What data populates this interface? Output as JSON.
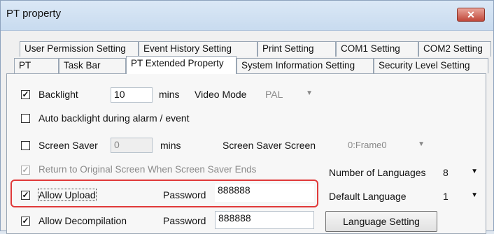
{
  "window": {
    "title": "PT property",
    "close_glyph": "✕"
  },
  "tabs_row1": [
    "User Permission Setting",
    "Event History Setting",
    "Print Setting",
    "COM1 Setting",
    "COM2 Setting"
  ],
  "tabs_row2": [
    "PT",
    "Task Bar",
    "PT Extended Property",
    "System Information Setting",
    "Security Level Setting"
  ],
  "active_tab": "PT Extended Property",
  "backlight": {
    "label": "Backlight",
    "checked": true,
    "value": "10",
    "unit": "mins"
  },
  "video_mode": {
    "label": "Video Mode",
    "value": "PAL"
  },
  "auto_backlight": {
    "label": "Auto backlight during alarm / event",
    "checked": false
  },
  "screen_saver": {
    "label": "Screen Saver",
    "checked": false,
    "value": "0",
    "unit": "mins"
  },
  "screen_saver_screen": {
    "label": "Screen Saver Screen",
    "value": "0:Frame0"
  },
  "return_original": {
    "label": "Return to Original Screen When Screen Saver Ends",
    "checked": true,
    "disabled": true
  },
  "languages": {
    "label": "Number of Languages",
    "value": "8"
  },
  "default_language": {
    "label": "Default Language",
    "value": "1"
  },
  "allow_upload": {
    "label": "Allow Upload",
    "checked": true,
    "password_label": "Password",
    "password": "888888"
  },
  "allow_decompilation": {
    "label": "Allow Decompilation",
    "checked": true,
    "password_label": "Password",
    "password": "888888"
  },
  "language_setting_button": "Language Setting",
  "check_glyph": "✓",
  "caret_glyph": "▼",
  "colors": {
    "highlight": "#e03a3a",
    "titlebar": "#c8dbef",
    "close": "#c0473a"
  }
}
